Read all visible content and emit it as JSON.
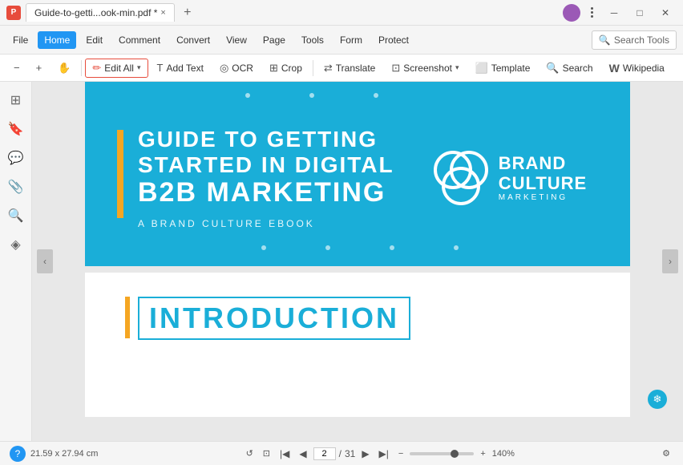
{
  "titleBar": {
    "tab": {
      "label": "Guide-to-getti...ook-min.pdf *",
      "closeLabel": "×"
    },
    "addTabLabel": "+",
    "windowControls": {
      "minimize": "─",
      "maximize": "□",
      "close": "✕"
    }
  },
  "menuBar": {
    "items": [
      {
        "id": "file",
        "label": "File"
      },
      {
        "id": "home",
        "label": "Home",
        "active": true
      },
      {
        "id": "edit",
        "label": "Edit"
      },
      {
        "id": "comment",
        "label": "Comment"
      },
      {
        "id": "convert",
        "label": "Convert"
      },
      {
        "id": "view",
        "label": "View"
      },
      {
        "id": "page",
        "label": "Page"
      },
      {
        "id": "tools",
        "label": "Tools"
      },
      {
        "id": "form",
        "label": "Form"
      },
      {
        "id": "protect",
        "label": "Protect"
      }
    ],
    "searchTools": "Search Tools"
  },
  "toolbar": {
    "buttons": [
      {
        "id": "zoom-out",
        "icon": "−",
        "label": ""
      },
      {
        "id": "zoom-in",
        "icon": "+",
        "label": ""
      },
      {
        "id": "hand",
        "icon": "✋",
        "label": ""
      },
      {
        "id": "edit-all",
        "icon": "✏",
        "label": "Edit All",
        "hasChevron": true,
        "active": true
      },
      {
        "id": "add-text",
        "icon": "T",
        "label": "Add Text"
      },
      {
        "id": "ocr",
        "icon": "◎",
        "label": "OCR"
      },
      {
        "id": "crop",
        "icon": "⊞",
        "label": "Crop"
      },
      {
        "id": "translate",
        "icon": "⇄",
        "label": "Translate"
      },
      {
        "id": "screenshot",
        "icon": "⊡",
        "label": "Screenshot",
        "hasChevron": true
      },
      {
        "id": "template",
        "icon": "⬜",
        "label": "Template"
      },
      {
        "id": "search",
        "icon": "🔍",
        "label": "Search"
      },
      {
        "id": "wikipedia",
        "icon": "W",
        "label": "Wikipedia"
      }
    ]
  },
  "sidebar": {
    "icons": [
      {
        "id": "thumbnails",
        "icon": "⊞"
      },
      {
        "id": "bookmark",
        "icon": "🔖"
      },
      {
        "id": "comment",
        "icon": "💬"
      },
      {
        "id": "attachment",
        "icon": "📎"
      },
      {
        "id": "search",
        "icon": "🔍"
      },
      {
        "id": "layers",
        "icon": "◈"
      }
    ]
  },
  "coverPage": {
    "title1": "GUIDE TO GETTING",
    "title2": "STARTED IN DIGITAL",
    "title3": "B2B MARKETING",
    "subtitle": "A BRAND CULTURE EBOOK",
    "brandName1": "BRAND",
    "brandName2": "CULTURE",
    "brandSub": "MARKETING"
  },
  "page2": {
    "introText": "INTRODUCTION"
  },
  "statusBar": {
    "dimensions": "21.59 x 27.94 cm",
    "currentPage": "2",
    "totalPages": "31",
    "zoomLevel": "140%"
  }
}
